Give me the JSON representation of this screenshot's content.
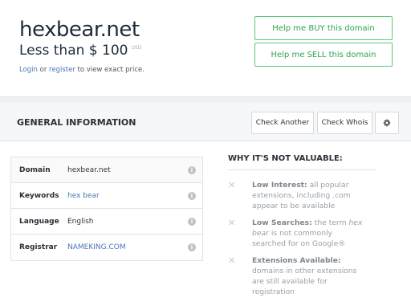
{
  "header": {
    "domain": "hexbear.net",
    "price_text": "Less than $ 100",
    "currency": "USD",
    "login_link": "Login",
    "or_text": "or",
    "register_link": "register",
    "login_suffix": "to view exact price."
  },
  "actions": {
    "buy_label": "Help me BUY this domain",
    "sell_label": "Help me SELL this domain"
  },
  "section": {
    "title": "GENERAL INFORMATION",
    "check_another_label": "Check Another",
    "check_whois_label": "Check Whois",
    "gear_icon": "gear-icon"
  },
  "info": {
    "rows": [
      {
        "label": "Domain",
        "value": "hexbear.net"
      },
      {
        "label": "Keywords",
        "value": "hex bear"
      },
      {
        "label": "Language",
        "value": "English"
      },
      {
        "label": "Registrar",
        "value": "NAMEKING.COM"
      }
    ],
    "info_icon": "info-icon"
  },
  "why": {
    "title": "WHY IT'S NOT VALUABLE:",
    "items": [
      {
        "heading": "Low Interest:",
        "text": "all popular extensions, including .com appear to be available"
      },
      {
        "heading": "Low Searches:",
        "text_pre": "the term",
        "term": "hex bear",
        "text_post": "is not commonly searched for on Google®"
      },
      {
        "heading": "Extensions Available:",
        "text": "domains in other extensions are still available for registration"
      }
    ],
    "x_icon": "x-icon"
  },
  "colors": {
    "accent_green": "#2ea44f",
    "link_blue": "#4a77b4",
    "title_dark": "#1f2b3a"
  }
}
